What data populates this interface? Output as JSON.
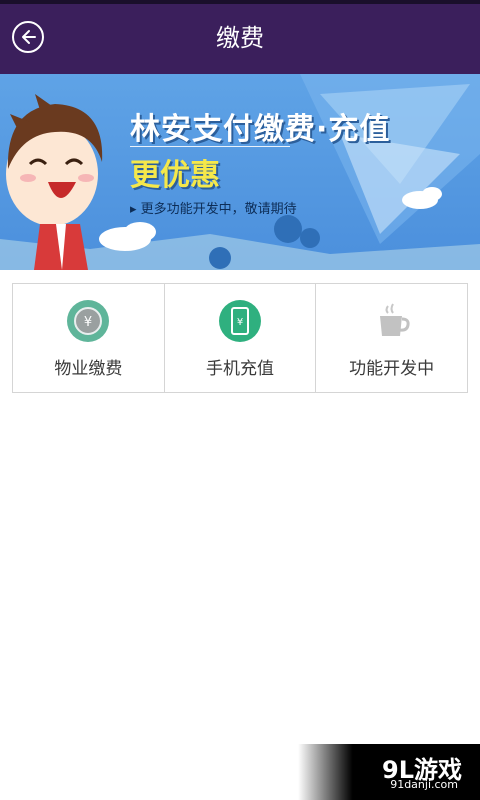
{
  "header": {
    "title": "缴费"
  },
  "banner": {
    "title": "林安支付缴费·充值",
    "subtitle": "更优惠",
    "note": "更多功能开发中，敬请期待"
  },
  "services": [
    {
      "label": "物业缴费",
      "icon": "yen-coin-icon",
      "color": "#5fb59a"
    },
    {
      "label": "手机充值",
      "icon": "mobile-yen-icon",
      "color": "#2fb07f"
    },
    {
      "label": "功能开发中",
      "icon": "coffee-cup-icon",
      "color": "#bdbdbd"
    }
  ],
  "watermark": {
    "brand": "9L游戏",
    "url": "91danji.com"
  },
  "colors": {
    "topbar": "#3b1f5c",
    "banner": "#5fa3e6"
  }
}
